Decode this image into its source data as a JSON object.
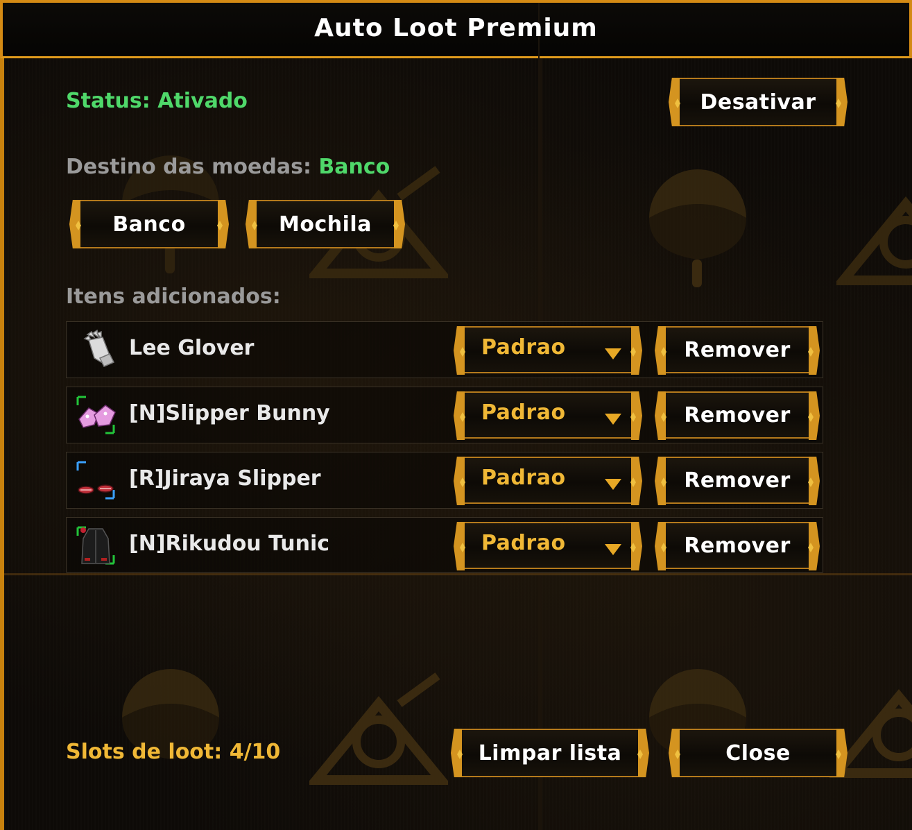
{
  "window": {
    "title": "Auto Loot Premium"
  },
  "status": {
    "label": "Status: Ativado",
    "toggle_button": "Desativar",
    "color": "#4fd86a"
  },
  "coins": {
    "label": "Destino das moedas:",
    "value": "Banco",
    "options": [
      "Banco",
      "Mochila"
    ]
  },
  "items_section": {
    "label": "Itens adicionados:",
    "items": [
      {
        "name": "Lee Glover",
        "icon": "glove-icon",
        "mode": "Padrao",
        "remove_label": "Remover",
        "rarity_color": ""
      },
      {
        "name": "[N]Slipper Bunny",
        "icon": "bunny-slipper-icon",
        "mode": "Padrao",
        "remove_label": "Remover",
        "rarity_color": "#22c43a"
      },
      {
        "name": "[R]Jiraya Slipper",
        "icon": "jiraya-slipper-icon",
        "mode": "Padrao",
        "remove_label": "Remover",
        "rarity_color": "#3aa0ff"
      },
      {
        "name": "[N]Rikudou Tunic",
        "icon": "tunic-icon",
        "mode": "Padrao",
        "remove_label": "Remover",
        "rarity_color": "#22c43a"
      }
    ]
  },
  "footer": {
    "slots_label": "Slots de loot: 4/10",
    "clear_button": "Limpar lista",
    "close_button": "Close"
  },
  "colors": {
    "accent_gold": "#f0b836",
    "frame_orange": "#d48a14",
    "status_green": "#4fd86a"
  }
}
